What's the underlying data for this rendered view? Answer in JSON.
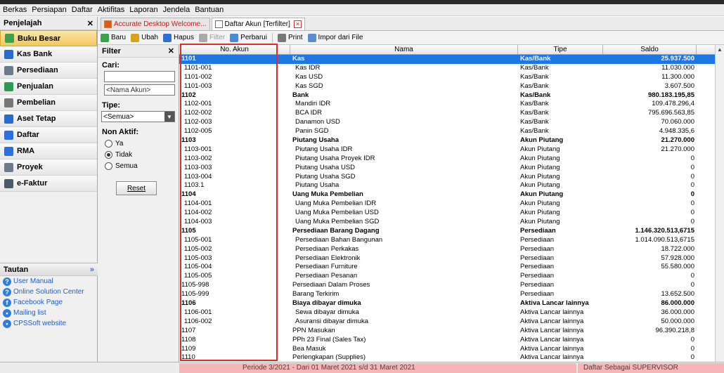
{
  "menu": [
    "Berkas",
    "Persiapan",
    "Daftar",
    "Aktifitas",
    "Laporan",
    "Jendela",
    "Bantuan"
  ],
  "left": {
    "title": "Penjelajah",
    "items": [
      {
        "label": "Buku Besar",
        "icon": "ledger-icon",
        "active": true
      },
      {
        "label": "Kas Bank",
        "icon": "bank-icon"
      },
      {
        "label": "Persediaan",
        "icon": "inventory-icon"
      },
      {
        "label": "Penjualan",
        "icon": "sales-icon"
      },
      {
        "label": "Pembelian",
        "icon": "cart-icon"
      },
      {
        "label": "Aset Tetap",
        "icon": "building-icon"
      },
      {
        "label": "Daftar",
        "icon": "list-icon"
      },
      {
        "label": "RMA",
        "icon": "rma-icon"
      },
      {
        "label": "Proyek",
        "icon": "project-icon"
      },
      {
        "label": "e-Faktur",
        "icon": "invoice-icon"
      }
    ]
  },
  "tautan": {
    "title": "Tautan",
    "links": [
      "User Manual",
      "Online Solution Center",
      "Facebook Page",
      "Mailing list",
      "CPSSoft website"
    ]
  },
  "filter": {
    "title": "Filter",
    "cari_label": "Cari:",
    "cari_value": "",
    "nama_placeholder": "<Nama Akun>",
    "tipe_label": "Tipe:",
    "tipe_value": "<Semua>",
    "nonaktif_label": "Non Aktif:",
    "radios": [
      {
        "label": "Ya",
        "checked": false
      },
      {
        "label": "Tidak",
        "checked": true
      },
      {
        "label": "Semua",
        "checked": false
      }
    ],
    "reset_label": "Reset"
  },
  "tabs": [
    {
      "label": "Accurate Desktop Welcome...",
      "active": false
    },
    {
      "label": "Daftar Akun [Terfilter]",
      "active": true
    }
  ],
  "toolbar": [
    {
      "label": "Baru",
      "icon": "new-icon",
      "color": "#3aa24a"
    },
    {
      "label": "Ubah",
      "icon": "edit-icon",
      "color": "#d9a21c"
    },
    {
      "label": "Hapus",
      "icon": "delete-icon",
      "color": "#2f6fd8"
    },
    {
      "label": "Filter",
      "icon": "filter-icon",
      "color": "#aaaaaa",
      "disabled": true
    },
    {
      "label": "Perbarui",
      "icon": "refresh-icon",
      "color": "#4a8bd8"
    },
    {
      "label": "Print",
      "icon": "print-icon",
      "color": "#777777"
    },
    {
      "label": "Impor dari File",
      "icon": "import-icon",
      "color": "#5a8cd0"
    }
  ],
  "columns": [
    "No. Akun",
    "Nama",
    "Tipe",
    "Saldo"
  ],
  "rows": [
    [
      "1101",
      "Kas",
      "Kas/Bank",
      "25.937.500",
      "h"
    ],
    [
      "1101-001",
      "Kas IDR",
      "Kas/Bank",
      "11.030.000",
      ""
    ],
    [
      "1101-002",
      "Kas USD",
      "Kas/Bank",
      "11.300.000",
      ""
    ],
    [
      "1101-003",
      "Kas SGD",
      "Kas/Bank",
      "3.607.500",
      ""
    ],
    [
      "1102",
      "Bank",
      "Kas/Bank",
      "980.183.195,85",
      "h"
    ],
    [
      "1102-001",
      "Mandiri IDR",
      "Kas/Bank",
      "109.478.296,4",
      ""
    ],
    [
      "1102-002",
      "BCA IDR",
      "Kas/Bank",
      "795.696.563,85",
      ""
    ],
    [
      "1102-003",
      "Danamon USD",
      "Kas/Bank",
      "70.060.000",
      ""
    ],
    [
      "1102-005",
      "Panin SGD",
      "Kas/Bank",
      "4.948.335,6",
      ""
    ],
    [
      "1103",
      "Piutang Usaha",
      "Akun Piutang",
      "21.270.000",
      "h"
    ],
    [
      "1103-001",
      "Piutang Usaha IDR",
      "Akun Piutang",
      "21.270.000",
      ""
    ],
    [
      "1103-002",
      "Piutang Usaha Proyek IDR",
      "Akun Piutang",
      "0",
      ""
    ],
    [
      "1103-003",
      "Piutang Usaha USD",
      "Akun Piutang",
      "0",
      ""
    ],
    [
      "1103-004",
      "Piutang Usaha SGD",
      "Akun Piutang",
      "0",
      ""
    ],
    [
      "1103.1",
      "Piutang Usaha",
      "Akun Piutang",
      "0",
      ""
    ],
    [
      "1104",
      "Uang Muka Pembelian",
      "Akun Piutang",
      "0",
      "h"
    ],
    [
      "1104-001",
      "Uang Muka Pembelian IDR",
      "Akun Piutang",
      "0",
      ""
    ],
    [
      "1104-002",
      "Uang Muka Pembelian USD",
      "Akun Piutang",
      "0",
      ""
    ],
    [
      "1104-003",
      "Uang Muka Pembelian SGD",
      "Akun Piutang",
      "0",
      ""
    ],
    [
      "1105",
      "Persediaan Barang Dagang",
      "Persediaan",
      "1.146.320.513,6715",
      "h"
    ],
    [
      "1105-001",
      "Persediaan Bahan Bangunan",
      "Persediaan",
      "1.014.090.513,6715",
      ""
    ],
    [
      "1105-002",
      "Persediaan Perkakas",
      "Persediaan",
      "18.722.000",
      ""
    ],
    [
      "1105-003",
      "Persediaan Elektronik",
      "Persediaan",
      "57.928.000",
      ""
    ],
    [
      "1105-004",
      "Persediaan Furniture",
      "Persediaan",
      "55.580.000",
      ""
    ],
    [
      "1105-005",
      "Persediaan Pesanan",
      "Persediaan",
      "0",
      ""
    ],
    [
      "1105-998",
      "Persediaan Dalam Proses",
      "Persediaan",
      "0",
      "f"
    ],
    [
      "1105-999",
      "Barang Terkirim",
      "Persediaan",
      "13.652.500",
      "f"
    ],
    [
      "1106",
      "Biaya dibayar dimuka",
      "Aktiva Lancar lainnya",
      "86.000.000",
      "h"
    ],
    [
      "1106-001",
      "Sewa dibayar dimuka",
      "Aktiva Lancar lainnya",
      "36.000.000",
      ""
    ],
    [
      "1106-002",
      "Asuransi dibayar dimuka",
      "Aktiva Lancar lainnya",
      "50.000.000",
      ""
    ],
    [
      "1107",
      "PPN Masukan",
      "Aktiva Lancar lainnya",
      "96.390.218,8",
      "f"
    ],
    [
      "1108",
      "PPh 23 Final (Sales Tax)",
      "Aktiva Lancar lainnya",
      "0",
      "f"
    ],
    [
      "1109",
      "Bea Masuk",
      "Aktiva Lancar lainnya",
      "0",
      "f"
    ],
    [
      "1110",
      "Perlengkapan (Supplies)",
      "Aktiva Lancar lainnya",
      "0",
      "f"
    ]
  ],
  "status": {
    "periode": "Periode 3/2021 - Dari 01 Maret 2021 s/d 31 Maret 2021",
    "user": "Daftar Sebagai SUPERVISOR"
  }
}
